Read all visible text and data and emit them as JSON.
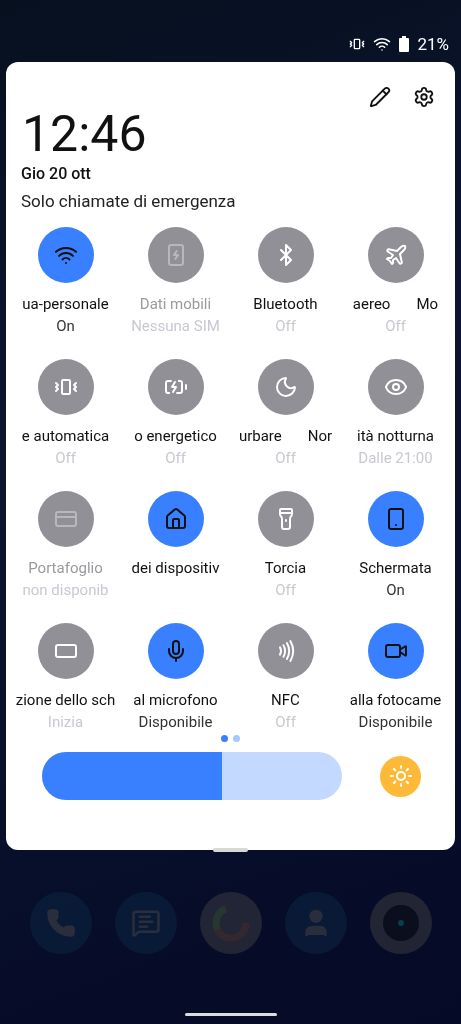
{
  "status_bar": {
    "battery": "21%"
  },
  "header": {
    "time": "12:46",
    "date": "Gio 20 ott",
    "network_status": "Solo chiamate di emergenza"
  },
  "tiles": [
    {
      "label": "ua-personale",
      "subtitle": "On",
      "on": true,
      "disabled": false
    },
    {
      "label": "Dati mobili",
      "subtitle": "Nessuna SIM",
      "on": false,
      "disabled": true
    },
    {
      "label": "Bluetooth",
      "subtitle": "Off",
      "on": false,
      "disabled": false
    },
    {
      "label": "aereo       Mo",
      "subtitle": "Off",
      "on": false,
      "disabled": false
    },
    {
      "label": "e automatica",
      "subtitle": "Off",
      "on": false,
      "disabled": false
    },
    {
      "label": "o energetico",
      "subtitle": "Off",
      "on": false,
      "disabled": false
    },
    {
      "label": "urbare       Nor",
      "subtitle": "Off",
      "on": false,
      "disabled": false
    },
    {
      "label": "ità notturna",
      "subtitle": "Dalle 21:00",
      "on": false,
      "disabled": false
    },
    {
      "label": "Portafoglio",
      "subtitle": "non disponib",
      "on": false,
      "disabled": true
    },
    {
      "label": "dei dispositiv",
      "on": true,
      "disabled": false
    },
    {
      "label": "Torcia",
      "subtitle": "Off",
      "on": false,
      "disabled": false
    },
    {
      "label": "Schermata",
      "subtitle": "On",
      "on": true,
      "disabled": false
    },
    {
      "label": "zione dello sch",
      "subtitle": "Inizia",
      "on": false,
      "disabled": false
    },
    {
      "label": "al microfono",
      "subtitle": "Disponibile",
      "on": true,
      "disabled": false
    },
    {
      "label": "NFC",
      "subtitle": "Off",
      "on": false,
      "disabled": false
    },
    {
      "label": "alla fotocame",
      "subtitle": "Disponibile",
      "on": true,
      "disabled": false
    }
  ],
  "pages": [
    {
      "selected": true
    },
    {
      "selected": false
    }
  ],
  "brightness": {
    "level": 0.6
  }
}
